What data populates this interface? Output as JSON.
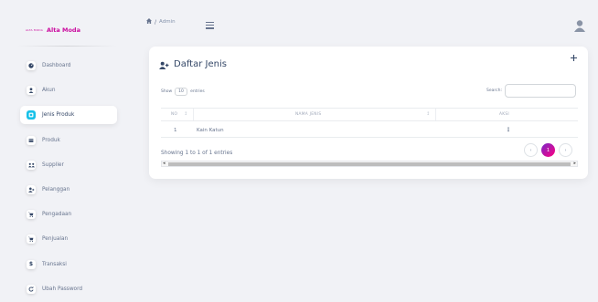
{
  "brand": {
    "logo_text": "ALTA MODA",
    "name": "Alta Moda"
  },
  "sidebar": {
    "items": [
      {
        "label": "Dashboard",
        "icon": "dashboard-icon",
        "active": false
      },
      {
        "label": "Akun",
        "icon": "user-icon",
        "active": false
      },
      {
        "label": "Jenis Produk",
        "icon": "tag-icon",
        "active": true
      },
      {
        "label": "Produk",
        "icon": "box-icon",
        "active": false
      },
      {
        "label": "Supplier",
        "icon": "users-icon",
        "active": false
      },
      {
        "label": "Pelanggan",
        "icon": "user-plus-icon",
        "active": false
      },
      {
        "label": "Pengadaan",
        "icon": "cart-icon",
        "active": false
      },
      {
        "label": "Penjualan",
        "icon": "cart-icon",
        "active": false
      },
      {
        "label": "Transaksi",
        "icon": "dollar-icon",
        "active": false
      },
      {
        "label": "Ubah Password",
        "icon": "refresh-icon",
        "active": false
      }
    ]
  },
  "breadcrumb": {
    "home_icon": "home-icon",
    "separator": "/",
    "current": "Admin"
  },
  "card": {
    "title": "Daftar Jenis",
    "title_icon": "user-plus-icon",
    "add_icon": "plus-icon"
  },
  "table_controls": {
    "show_label": "Show",
    "page_length": "10",
    "entries_label": "entries",
    "search_label": "Search:",
    "search_value": ""
  },
  "table": {
    "columns": [
      "NO",
      "NAMA JENIS",
      "AKSI"
    ],
    "rows": [
      {
        "no": "1",
        "nama_jenis": "Kain Katun",
        "aksi_icon": "kebab-icon"
      }
    ]
  },
  "footer": {
    "info": "Showing 1 to 1 of 1 entries",
    "prev": "‹",
    "current_page": "1",
    "next": "›"
  },
  "colors": {
    "accent": "#17c1e8",
    "brand": "#cb0c9f",
    "pager_active_from": "#7928ca",
    "pager_active_to": "#ff0080"
  }
}
